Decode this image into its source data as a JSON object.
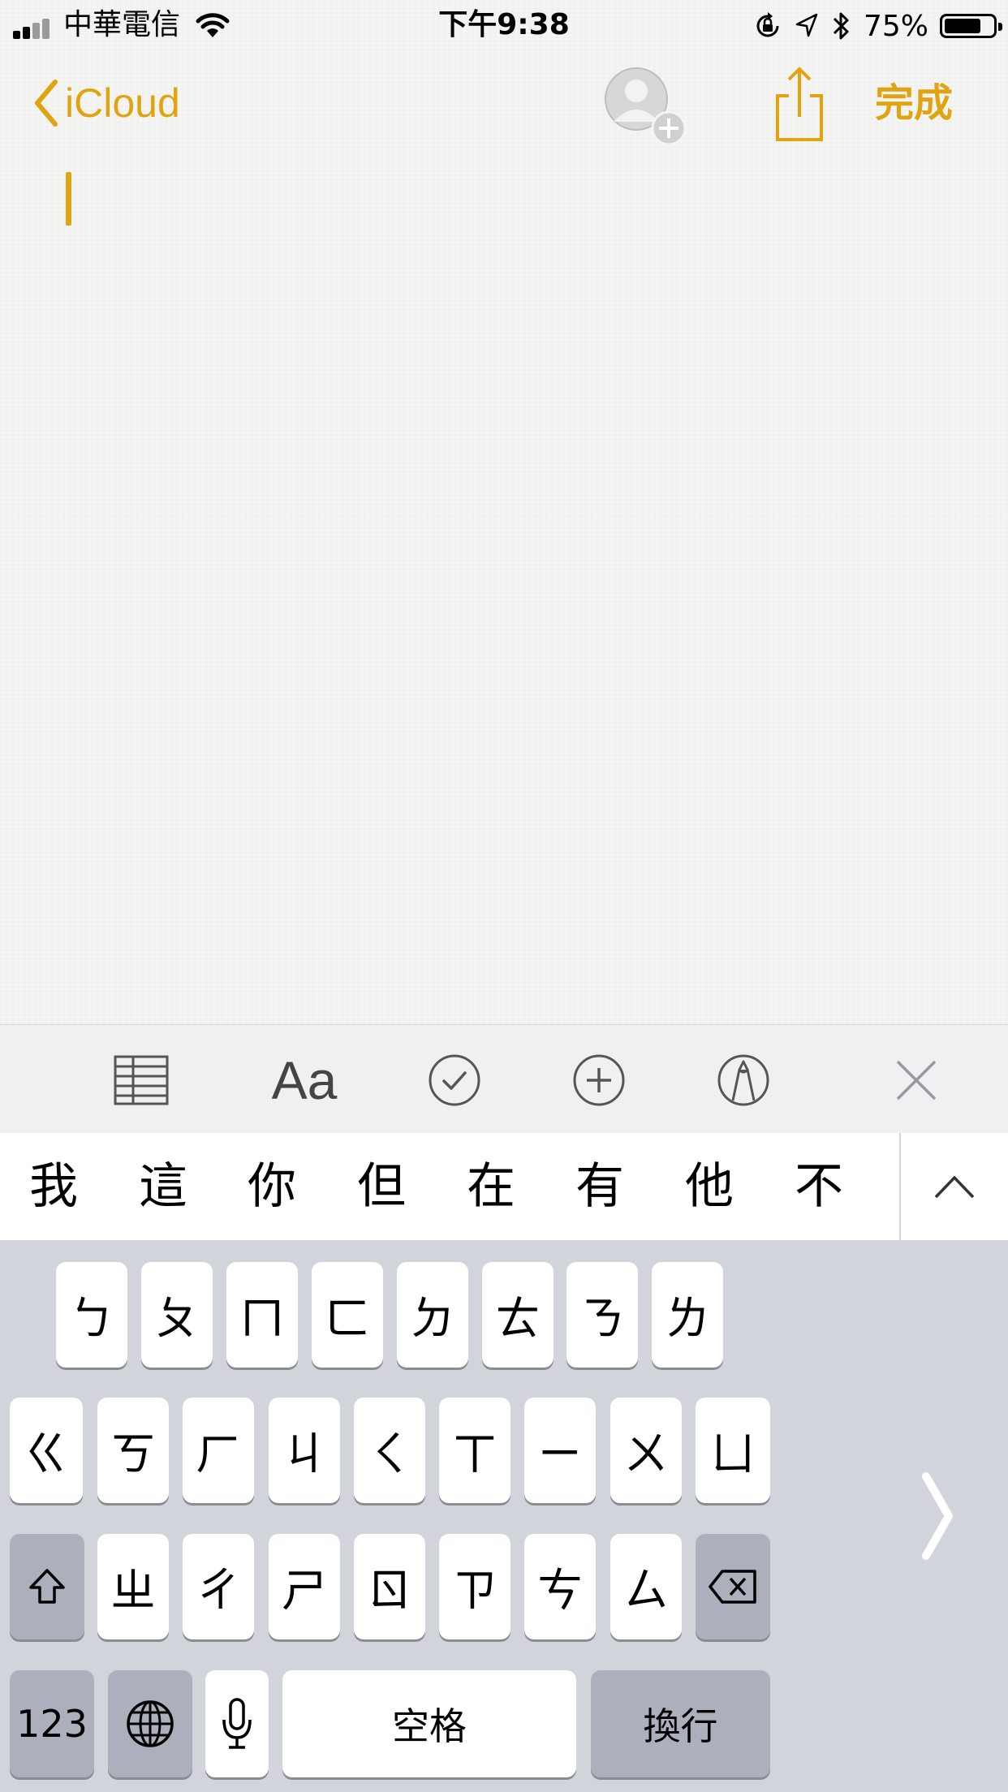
{
  "status_bar": {
    "carrier": "中華電信",
    "time": "下午9:38",
    "battery_percent": "75%",
    "battery_level": 0.75
  },
  "nav": {
    "back_label": "iCloud",
    "done_label": "完成",
    "accent_color": "#e0a412"
  },
  "toolbar": {
    "text_style_label": "Aa",
    "icons": [
      "table-icon",
      "text-style-icon",
      "checklist-icon",
      "add-icon",
      "markup-icon",
      "close-icon"
    ]
  },
  "candidates": [
    "我",
    "這",
    "你",
    "但",
    "在",
    "有",
    "他",
    "不"
  ],
  "keyboard": {
    "row1": [
      "ㄅ",
      "ㄆ",
      "ㄇ",
      "ㄈ",
      "ㄉ",
      "ㄊ",
      "ㄋ",
      "ㄌ"
    ],
    "row2": [
      "ㄍ",
      "ㄎ",
      "ㄏ",
      "ㄐ",
      "ㄑ",
      "ㄒ",
      "ㄧ",
      "ㄨ",
      "ㄩ"
    ],
    "row3": [
      "ㄓ",
      "ㄔ",
      "ㄕ",
      "ㄖ",
      "ㄗ",
      "ㄘ",
      "ㄙ"
    ],
    "numbers_label": "123",
    "space_label": "空格",
    "return_label": "換行"
  }
}
